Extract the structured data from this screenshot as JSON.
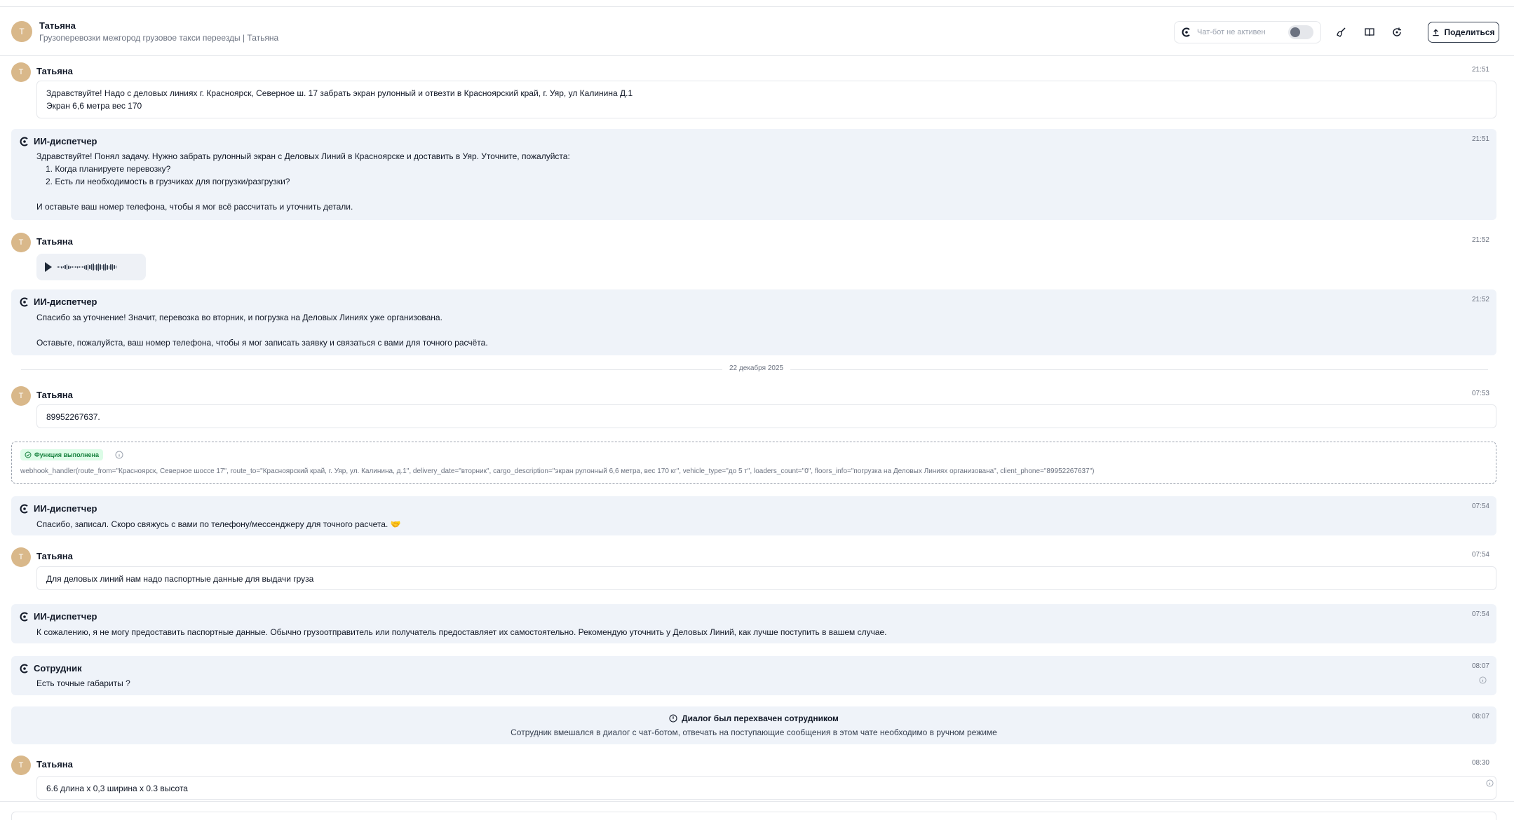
{
  "header": {
    "avatar_letter": "Т",
    "name": "Татьяна",
    "subtitle": "Грузоперевозки межгород грузовое такси переезды | Татьяна",
    "bot_status": "Чат-бот не активен",
    "share_label": "Поделиться"
  },
  "messages": {
    "m1": {
      "author": "Татьяна",
      "avatar": "Т",
      "time": "21:51",
      "line1": "Здравствуйте! Надо с деловых линиях г. Красноярск, Северное ш. 17 забрать экран рулонный и отвезти в Красноярский край, г. Уяр, ул Калинина Д.1",
      "line2": "Экран 6,6 метра вес 170"
    },
    "m2": {
      "author": "ИИ-диспетчер",
      "time": "21:51",
      "intro": "Здравствуйте! Понял задачу. Нужно забрать рулонный экран с Деловых Линий в Красноярске и доставить в Уяр. Уточните, пожалуйста:",
      "item1": "1. Когда планируете перевозку?",
      "item2": "2. Есть ли необходимость в грузчиках для погрузки/разгрузки?",
      "outro": "И оставьте ваш номер телефона, чтобы я мог всё рассчитать и уточнить детали."
    },
    "m3": {
      "author": "Татьяна",
      "avatar": "Т",
      "time": "21:52"
    },
    "m4": {
      "author": "ИИ-диспетчер",
      "time": "21:52",
      "line1": "Спасибо за уточнение! Значит, перевозка во вторник, и погрузка на Деловых Линиях уже организована.",
      "line2": "Оставьте, пожалуйста, ваш номер телефона, чтобы я мог записать заявку и связаться с вами для точного расчёта."
    },
    "date_divider": "22 декабря 2025",
    "m5": {
      "author": "Татьяна",
      "avatar": "Т",
      "time": "07:53",
      "text": "89952267637."
    },
    "function": {
      "badge": "Функция выполнена",
      "call": "webhook_handler(route_from=\"Красноярск, Северное шоссе 17\", route_to=\"Красноярский край, г. Уяр, ул. Калинина, д.1\", delivery_date=\"вторник\", cargo_description=\"экран рулонный 6,6 метра, вес 170 кг\", vehicle_type=\"до 5 т\", loaders_count=\"0\", floors_info=\"погрузка на Деловых Линиях организована\", client_phone=\"89952267637\")"
    },
    "m6": {
      "author": "ИИ-диспетчер",
      "time": "07:54",
      "text": "Спасибо, записал. Скоро свяжусь с вами по телефону/мессенджеру для точного расчета.",
      "emoji": "🤝"
    },
    "m7": {
      "author": "Татьяна",
      "avatar": "Т",
      "time": "07:54",
      "text": "Для деловых линий нам надо паспортные данные для выдачи груза"
    },
    "m8": {
      "author": "ИИ-диспетчер",
      "time": "07:54",
      "text": "К сожалению, я не могу предоставить паспортные данные. Обычно грузоотправитель или получатель предоставляет их самостоятельно. Рекомендую уточнить у Деловых Линий, как лучше поступить в вашем случае."
    },
    "m9": {
      "author": "Сотрудник",
      "time": "08:07",
      "text": "Есть точные габариты ?"
    },
    "intercept": {
      "title": "Диалог был перехвачен сотрудником",
      "desc": "Сотрудник вмешался в диалог с чат-ботом, отвечать на поступающие сообщения в этом чате необходимо в ручном режиме",
      "time": "08:07"
    },
    "m10": {
      "author": "Татьяна",
      "avatar": "Т",
      "time": "08:30",
      "text": "6.6 длина х 0,3 ширина х 0.3 высота"
    }
  },
  "colors": {
    "avatar": "#d9b88a",
    "bot_bg": "#eff3f9",
    "success": "#15803d"
  }
}
